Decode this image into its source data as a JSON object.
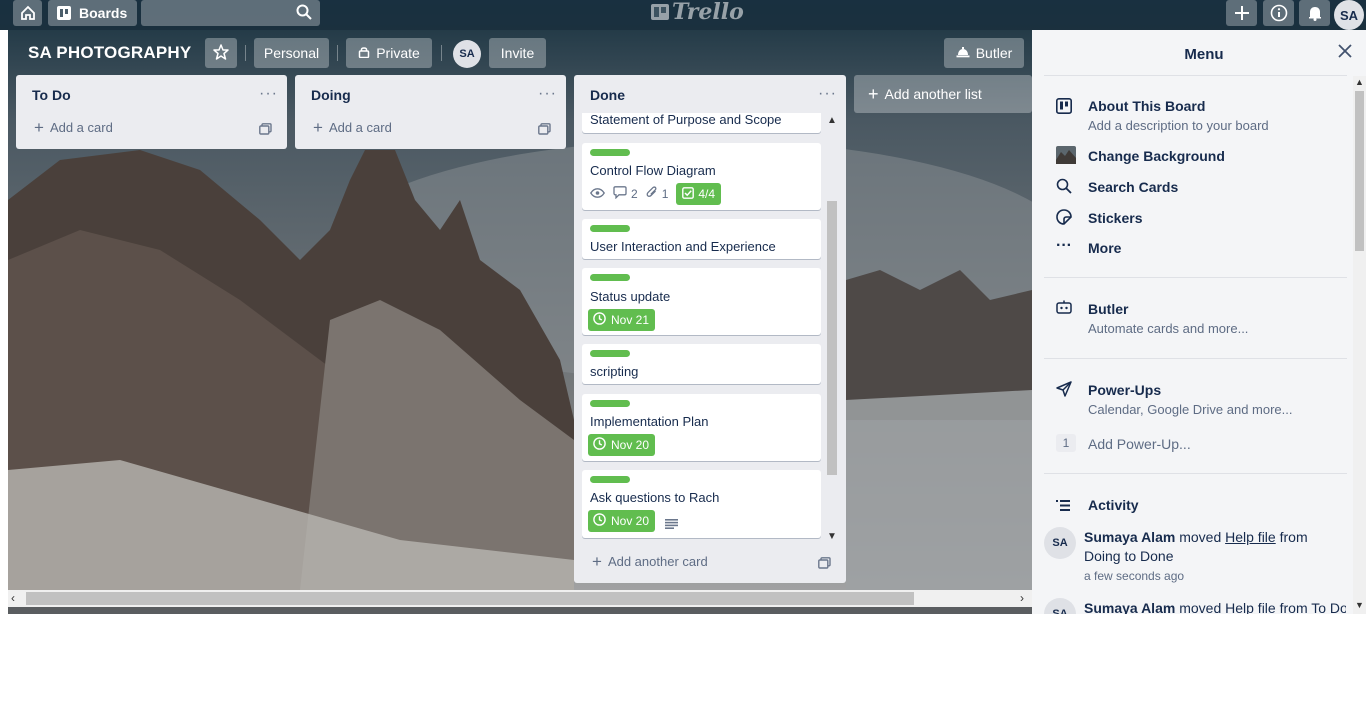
{
  "topbar": {
    "home_icon": "home-icon",
    "boards_label": "Boards",
    "search_placeholder": "",
    "logo_text": "Trello",
    "user_initials": "SA"
  },
  "board": {
    "title": "SA PHOTOGRAPHY",
    "personal_label": "Personal",
    "private_label": "Private",
    "member_initials": "SA",
    "invite_label": "Invite",
    "butler_label": "Butler",
    "add_list_label": "Add another list"
  },
  "lists": [
    {
      "title": "To Do",
      "add_card_label": "Add a card"
    },
    {
      "title": "Doing",
      "add_card_label": "Add a card"
    },
    {
      "title": "Done",
      "add_card_label": "Add another card",
      "cards": [
        {
          "title": "Statement of Purpose and Scope"
        },
        {
          "title": "Control Flow Diagram",
          "comments": "2",
          "attachments": "1",
          "checklist": "4/4"
        },
        {
          "title": "User Interaction and Experience"
        },
        {
          "title": "Status update",
          "due": "Nov 21"
        },
        {
          "title": "scripting"
        },
        {
          "title": "Implementation Plan",
          "due": "Nov 20"
        },
        {
          "title": "Ask questions to Rach",
          "due": "Nov 20"
        }
      ]
    }
  ],
  "menu": {
    "title": "Menu",
    "about_title": "About This Board",
    "about_sub": "Add a description to your board",
    "change_bg": "Change Background",
    "search_cards": "Search Cards",
    "stickers": "Stickers",
    "more": "More",
    "butler_title": "Butler",
    "butler_sub": "Automate cards and more...",
    "powerups_title": "Power-Ups",
    "powerups_sub": "Calendar, Google Drive and more...",
    "powerup_count": "1",
    "add_powerup": "Add Power-Up...",
    "activity_title": "Activity",
    "activity": [
      {
        "initials": "SA",
        "user": "Sumaya Alam",
        "verb": "moved",
        "card": "Help file",
        "from_to": "from Doing to Done",
        "time": "a few seconds ago"
      },
      {
        "initials": "SA",
        "user": "Sumaya Alam",
        "verb": "moved",
        "card": "Help file",
        "from_to": "from To Do"
      }
    ]
  },
  "colors": {
    "label_green": "#61bd4f",
    "list_bg": "#ebecf0",
    "text_dark": "#172b4d"
  }
}
